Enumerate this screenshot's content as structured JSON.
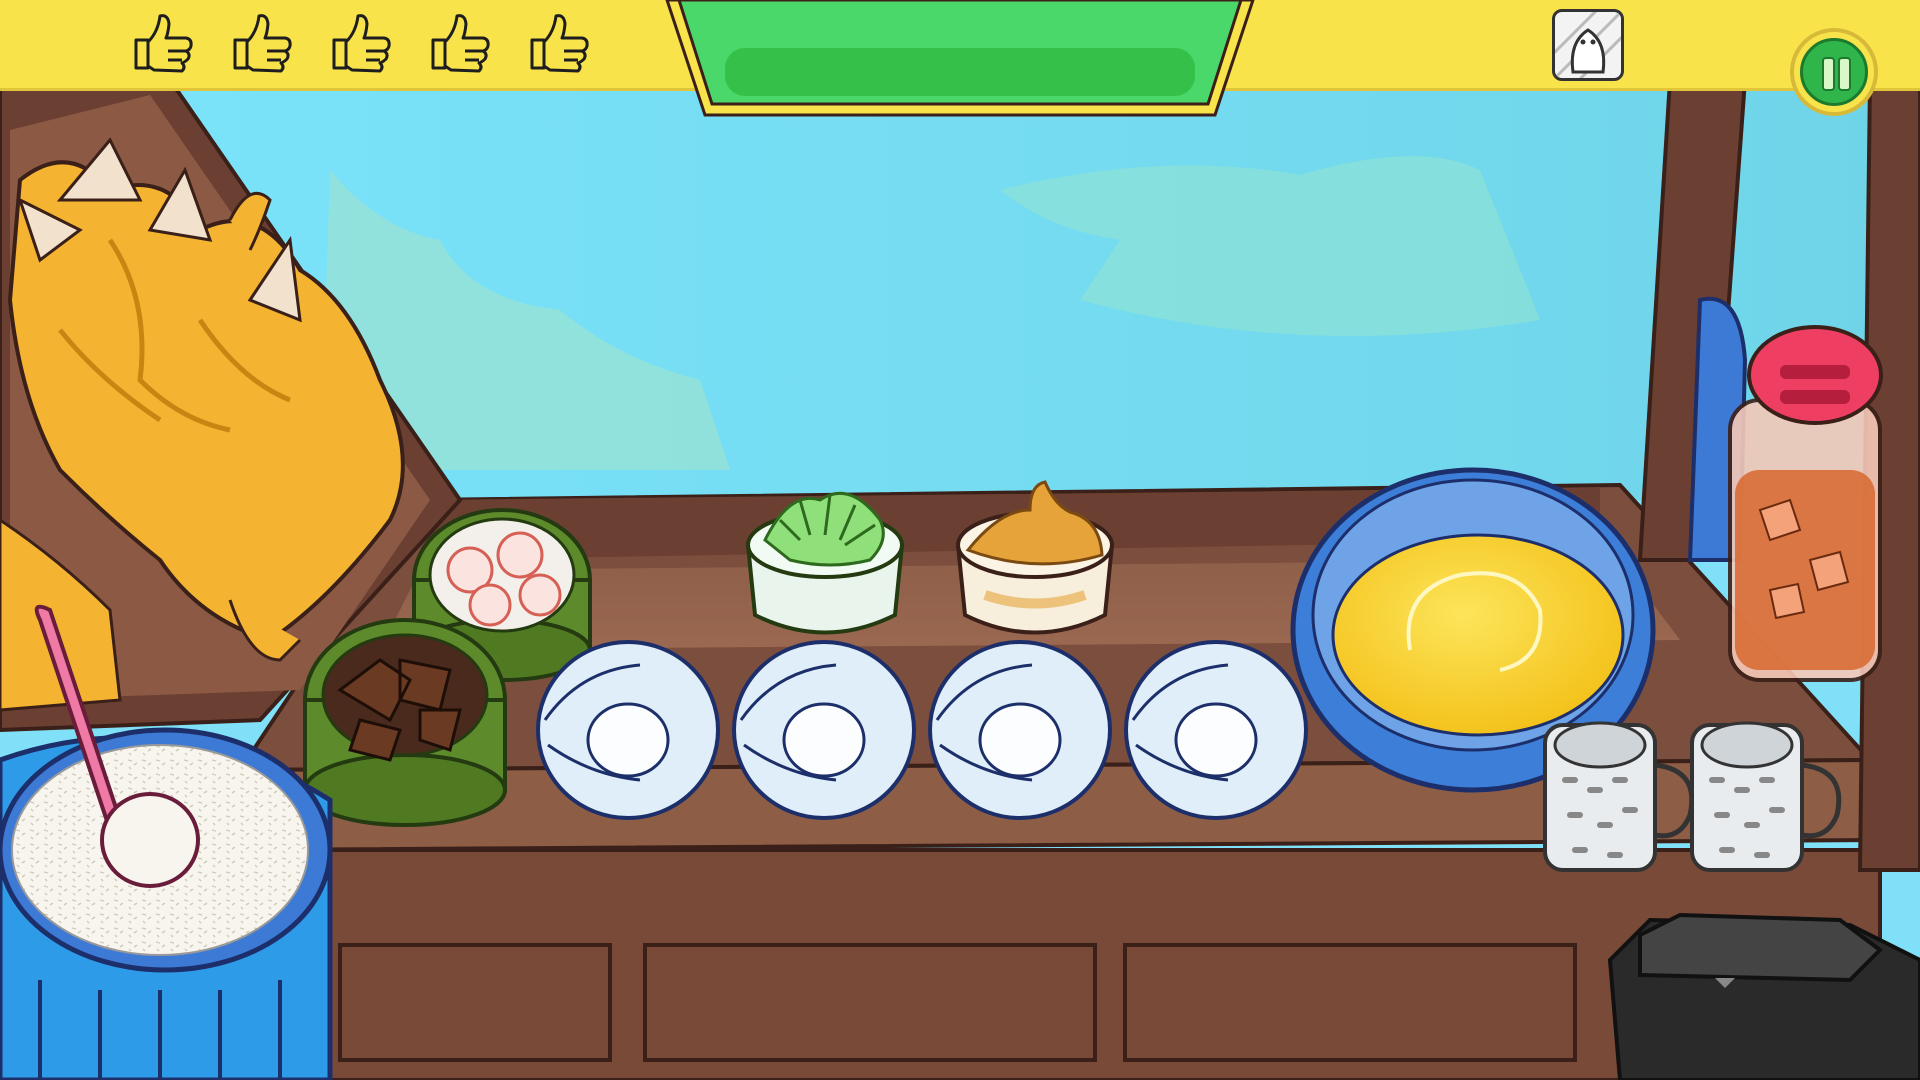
{
  "hud": {
    "ratings": [
      {
        "icon": "thumbs-up-icon",
        "filled": false
      },
      {
        "icon": "thumbs-up-icon",
        "filled": false
      },
      {
        "icon": "thumbs-up-icon",
        "filled": false
      },
      {
        "icon": "thumbs-up-icon",
        "filled": false
      },
      {
        "icon": "thumbs-up-icon",
        "filled": false
      }
    ],
    "timer": {
      "fraction_remaining": 1.0,
      "color": "#35c04a"
    },
    "customer_icon": "ghost-customer-icon",
    "pause_icon": "pause-icon"
  },
  "stall": {
    "left_display": [
      "roasted-chicken-icon",
      "rice-pot-icon",
      "rice-paddle-icon"
    ],
    "condiments": [
      "cucumber-slices-bowl",
      "braised-meat-pot",
      "chopped-scallion-bowl",
      "ginger-paste-bowl"
    ],
    "plates": [
      {
        "icon": "empty-plate-icon"
      },
      {
        "icon": "empty-plate-icon"
      },
      {
        "icon": "empty-plate-icon"
      },
      {
        "icon": "empty-plate-icon"
      }
    ],
    "soup_bowl": "chicken-soup-bowl-icon",
    "drink_jug": "iced-tea-jug-icon",
    "glasses": [
      {
        "icon": "empty-glass-icon"
      },
      {
        "icon": "empty-glass-icon"
      }
    ],
    "trash": "trash-bin-icon"
  },
  "colors": {
    "sky": "#7fe0f8",
    "topbar": "#f9e34b",
    "wood": "#8b5a44",
    "pause_green": "#2fb54a",
    "plate": "#dfeef8",
    "soup": "#f9d230",
    "bowl_blue": "#3c7ed8"
  }
}
